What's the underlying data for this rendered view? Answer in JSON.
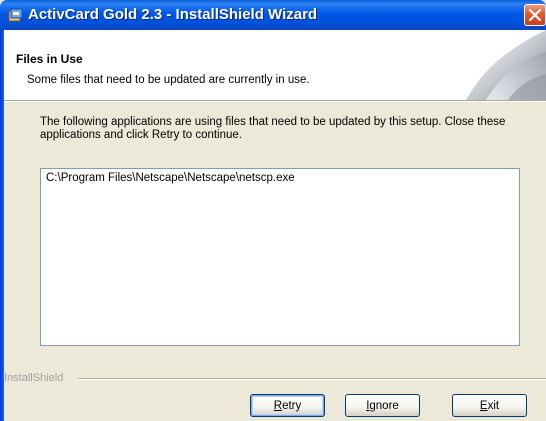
{
  "window": {
    "title": "ActivCard Gold 2.3 - InstallShield Wizard",
    "app_icon": "installer-icon",
    "close_icon": "close-icon"
  },
  "banner": {
    "title": "Files in Use",
    "subtitle": "Some files that need to be updated are currently in use."
  },
  "description": "The following applications are using files that need to be updated by this setup. Close these applications and click Retry to continue.",
  "files": [
    "C:\\Program Files\\Netscape\\Netscape\\netscp.exe"
  ],
  "footer": {
    "brand": "InstallShield"
  },
  "buttons": {
    "retry": {
      "accel": "R",
      "rest": "etry"
    },
    "ignore": {
      "accel": "I",
      "rest": "gnore"
    },
    "exit": {
      "accel": "E",
      "rest": "xit"
    }
  },
  "colors": {
    "titlebar": "#0058e6",
    "close": "#e5582f",
    "dialog": "#ece9d8"
  }
}
